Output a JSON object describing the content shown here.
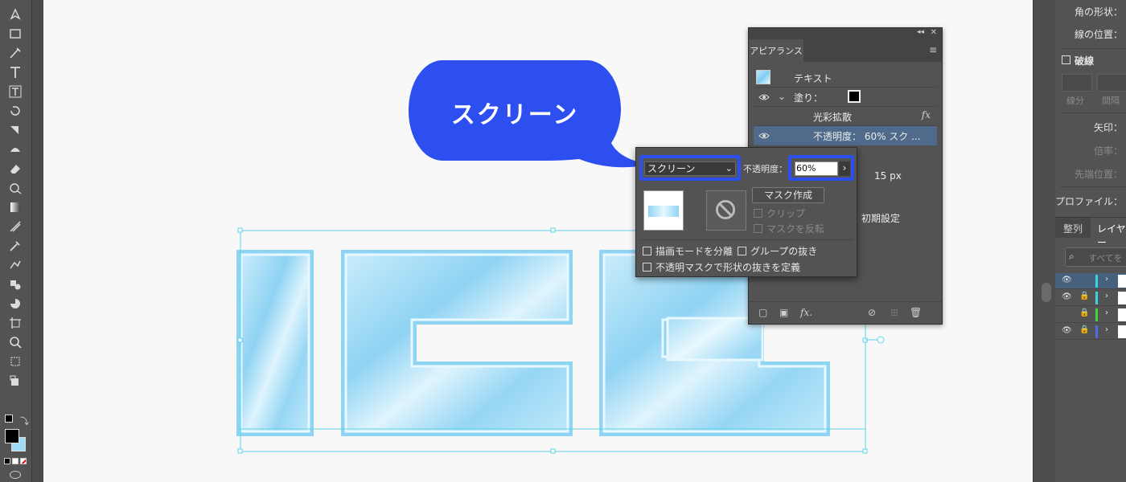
{
  "toolbar": {
    "tools": [
      "pen-tool-icon",
      "rectangle-tool-icon",
      "paintbrush-tool-icon",
      "type-tool-icon",
      "area-type-tool-icon",
      "rotate-tool-icon",
      "scale-tool-icon",
      "shaper-tool-icon",
      "eraser-tool-icon",
      "free-transform-tool-icon",
      "gradient-tool-icon",
      "mesh-tool-icon",
      "eyedropper-tool-icon",
      "blend-tool-icon",
      "symbol-sprayer-tool-icon",
      "pie-graph-tool-icon",
      "artboard-tool-icon",
      "zoom-tool-icon",
      "slice-tool-icon",
      "hand-tool-icon"
    ],
    "fill_color": "#000000",
    "stroke_color": "#9fdcf5"
  },
  "bubble": {
    "text": "スクリーン",
    "color": "#2e4ff0"
  },
  "transparency": {
    "blend_mode": "スクリーン",
    "opacity_label": "不透明度：",
    "opacity_value": "60%",
    "make_mask_label": "マスク作成",
    "clip_label": "クリップ",
    "invert_mask_label": "マスクを反転",
    "isolate_blending_label": "描画モードを分離",
    "knockout_group_label": "グループの抜き",
    "opacity_mask_knockout_label": "不透明マスクで形状の抜きを定義",
    "highlight_color": "#2e4ff0"
  },
  "appearance": {
    "tab_label": "アピアランス",
    "rows": {
      "text": "テキスト",
      "fill": "塗り：",
      "effect": "光彩拡散",
      "opacity": "不透明度： 60% スク ...",
      "stroke_size": "15 px",
      "default_label": "初期設定"
    }
  },
  "right_panel": {
    "corner_shape": "角の形状：",
    "stroke_position": "線の位置：",
    "dashed": "破線",
    "dash": "線分",
    "gap": "間隔",
    "arrowheads": "矢印：",
    "scale": "倍率：",
    "tip_position": "先端位置：",
    "profile": "プロファイル：",
    "tab_align": "整列",
    "tab_layers": "レイヤー",
    "search_placeholder": "すべてを"
  }
}
